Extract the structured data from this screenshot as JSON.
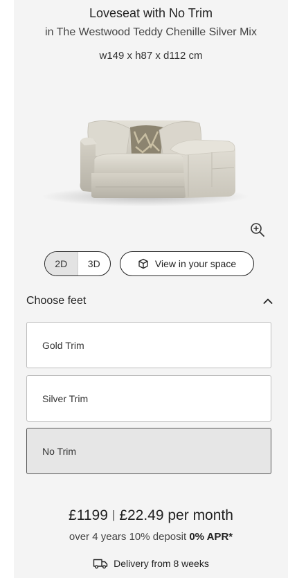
{
  "product": {
    "title": "Loveseat with No Trim",
    "subtitle": "in The Westwood Teddy Chenille Silver Mix",
    "dimensions": "w149 x h87 x d112 cm"
  },
  "view_toggle": {
    "option_2d": "2D",
    "option_3d": "3D",
    "selected": "2D",
    "view_in_space_label": "View in your space"
  },
  "feet_section": {
    "heading": "Choose feet",
    "options": [
      {
        "label": "Gold Trim",
        "selected": false
      },
      {
        "label": "Silver Trim",
        "selected": false
      },
      {
        "label": "No Trim",
        "selected": true
      }
    ]
  },
  "pricing": {
    "price": "£1199",
    "separator": "|",
    "monthly": "£22.49 per month",
    "finance_prefix": "over 4 years 10% deposit",
    "finance_apr": "0% APR*"
  },
  "delivery": {
    "label": "Delivery from 8 weeks"
  },
  "icons": {
    "zoom": "zoom-in-icon",
    "ar": "cube-icon",
    "chevron": "chevron-up-icon",
    "truck": "truck-icon"
  },
  "colors": {
    "panel_background": "#f4f4f4",
    "selected_option_background": "#e6e6e6",
    "text": "#222222"
  }
}
